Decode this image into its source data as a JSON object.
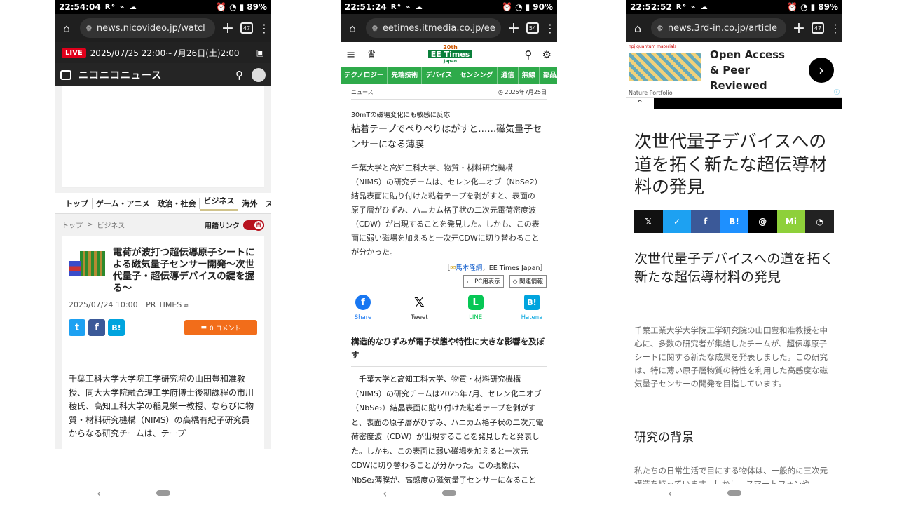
{
  "phone1": {
    "status": {
      "time": "22:54:04",
      "battery": "89%"
    },
    "browser": {
      "url": "news.nicovideo.jp/watcl",
      "tab_count": "47"
    },
    "live_banner": {
      "badge": "LIVE",
      "text": "2025/07/25 22:00~7月26日(土)2:00"
    },
    "site_logo": "ニコニコニュース",
    "categories": [
      "トップ",
      "ゲーム・アニメ",
      "政治・社会",
      "ビジネス",
      "海外",
      "スポ"
    ],
    "active_category": "ビジネス",
    "breadcrumb": [
      "トップ",
      ">",
      "ビジネス"
    ],
    "term_link_label": "用語リンク",
    "term_link_toggle": "百",
    "article": {
      "title": "電荷が波打つ超伝導原子シートによる磁気量子センサー開発～次世代量子・超伝導デバイスの鍵を握る～",
      "date": "2025/07/24 10:00",
      "source": "PR TIMES",
      "comment_label": "0 コメント",
      "body": "千葉工科大学大学院工学研究院の山田豊和准教授、同大大学院融合理工学府博士後期課程の市川稜氏、高知工科大学の稲見栄一教授、ならびに物質・材料研究機構（NIMS）の高橋有紀子研究員からなる研究チームは、テープ"
    }
  },
  "phone2": {
    "status": {
      "time": "22:51:24",
      "battery": "90%"
    },
    "browser": {
      "url": "eetimes.itmedia.co.jp/ee",
      "tab_count": "54"
    },
    "logo": {
      "anniv": "20th",
      "name": "EE Times",
      "sub": "Japan"
    },
    "tabs": [
      "テクノロジー",
      "先端技術",
      "デバイス",
      "センシング",
      "通信",
      "無線",
      "部品/材"
    ],
    "category": "ニュース",
    "date": "2025年7月25日",
    "subhead": "30mTの磁場変化にも敏感に反応",
    "title": "粘着テープでぺりぺりはがすと……磁気量子センサーになる薄膜",
    "lead": "千葉大学と高知工科大学、物質・材料研究機構（NIMS）の研究チームは、セレン化ニオブ（NbSe2）結晶表面に貼り付けた粘着テープを剥がすと、表面の原子層がひずみ、ハニカム格子状の二次元電荷密度波（CDW）が出現することを発見した。しかも、この表面に弱い磁場を加えると一次元CDWに切り替わることが分かった。",
    "author_prefix": "［",
    "author_name": "馬本隆綱",
    "author_suffix": "，EE Times Japan］",
    "pc_view": "PC用表示",
    "related": "関連情報",
    "share": [
      {
        "label": "Share",
        "icon": "f",
        "color": "#1877f2"
      },
      {
        "label": "Tweet",
        "icon": "𝕏",
        "color": "#000000"
      },
      {
        "label": "LINE",
        "icon": "L",
        "color": "#06c755"
      },
      {
        "label": "Hatena",
        "icon": "B!",
        "color": "#00a4de"
      }
    ],
    "section_title": "構造的なひずみが電子状態や特性に大きな影響を及ぼす",
    "body": "　千葉大学と高知工科大学、物質・材料研究機構（NIMS）の研究チームは2025年7月、セレン化ニオブ（NbSe₂）結晶表面に貼り付けた粘着テープを剥がすと、表面の原子層がひずみ、ハニカム格子状の二次元電荷密度波（CDW）が出現することを発見したと発表した。しかも、この表面に弱い磁場を加えると一次元CDWに切り替わることが分かった。この現象は、NbSe₂薄膜が、高感度の磁気量子センサーになること"
  },
  "phone3": {
    "status": {
      "time": "22:52:52",
      "battery": "89%"
    },
    "browser": {
      "url": "news.3rd-in.co.jp/article",
      "tab_count": "47"
    },
    "ad": {
      "brand": "npj quantum materials",
      "text": "Open Access & Peer Reviewed",
      "publisher": "Nature Portfolio"
    },
    "title": "次世代量子デバイスへの道を拓く新たな超伝導材料の発見",
    "share": [
      {
        "label": "𝕏",
        "color": "#111111"
      },
      {
        "label": "✓",
        "color": "#1da1f2"
      },
      {
        "label": "f",
        "color": "#3b5998"
      },
      {
        "label": "B!",
        "color": "#1e90ff"
      },
      {
        "label": "@",
        "color": "#000000"
      },
      {
        "label": "Mi",
        "color": "#8ed03a"
      },
      {
        "label": "◔",
        "color": "#222222"
      }
    ],
    "subtitle": "次世代量子デバイスへの道を拓く新たな超伝導材料の発見",
    "intro": "千葉工業大学大学院工学研究院の山田豊和准教授を中心に、多数の研究者が集結したチームが、超伝導原子シートに関する新たな成果を発表しました。この研究は、特に薄い原子層物質の特性を利用した高感度な磁気量子センサーの開発を目指しています。",
    "section_title": "研究の背景",
    "section_body": "私たちの日常生活で目にする物体は、一般的に三次元構造を持っています。しかし、スマートフォンや"
  }
}
